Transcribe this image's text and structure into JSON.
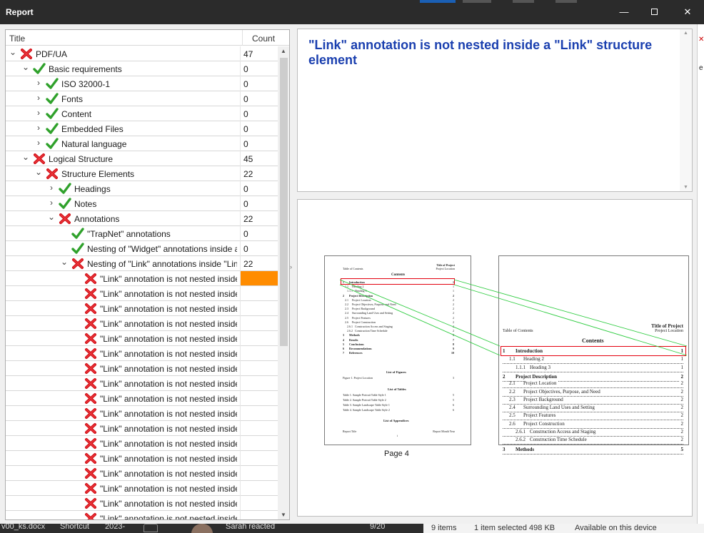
{
  "window": {
    "title": "Report",
    "controls": {
      "minimize": "—",
      "close": "✕"
    }
  },
  "tree": {
    "columns": {
      "title": "Title",
      "count": "Count"
    },
    "rows": [
      {
        "label": "PDF/UA",
        "count": "47",
        "status": "fail",
        "expander": "open",
        "level": 0
      },
      {
        "label": "Basic requirements",
        "count": "0",
        "status": "pass",
        "expander": "open",
        "level": 1
      },
      {
        "label": "ISO 32000-1",
        "count": "0",
        "status": "pass",
        "expander": "closed",
        "level": 2
      },
      {
        "label": "Fonts",
        "count": "0",
        "status": "pass",
        "expander": "closed",
        "level": 2
      },
      {
        "label": "Content",
        "count": "0",
        "status": "pass",
        "expander": "closed",
        "level": 2
      },
      {
        "label": "Embedded Files",
        "count": "0",
        "status": "pass",
        "expander": "closed",
        "level": 2
      },
      {
        "label": "Natural language",
        "count": "0",
        "status": "pass",
        "expander": "closed",
        "level": 2
      },
      {
        "label": "Logical Structure",
        "count": "45",
        "status": "fail",
        "expander": "open",
        "level": 1
      },
      {
        "label": "Structure Elements",
        "count": "22",
        "status": "fail",
        "expander": "open",
        "level": 2
      },
      {
        "label": "Headings",
        "count": "0",
        "status": "pass",
        "expander": "closed",
        "level": 3
      },
      {
        "label": "Notes",
        "count": "0",
        "status": "pass",
        "expander": "closed",
        "level": 3
      },
      {
        "label": "Annotations",
        "count": "22",
        "status": "fail",
        "expander": "open",
        "level": 3
      },
      {
        "label": "\"TrapNet\" annotations",
        "count": "0",
        "status": "pass",
        "expander": "none",
        "level": 4
      },
      {
        "label": "Nesting of \"Widget\" annotations inside a \"...",
        "count": "0",
        "status": "pass",
        "expander": "none",
        "level": 4
      },
      {
        "label": "Nesting of \"Link\" annotations inside \"Link\" ...",
        "count": "22",
        "status": "fail",
        "expander": "open",
        "level": 4
      },
      {
        "label": "\"Link\" annotation is not nested inside ...",
        "count": "",
        "status": "fail",
        "expander": "none",
        "level": 5,
        "selected": true
      },
      {
        "label": "\"Link\" annotation is not nested inside ...",
        "count": "",
        "status": "fail",
        "expander": "none",
        "level": 5
      },
      {
        "label": "\"Link\" annotation is not nested inside ...",
        "count": "",
        "status": "fail",
        "expander": "none",
        "level": 5
      },
      {
        "label": "\"Link\" annotation is not nested inside ...",
        "count": "",
        "status": "fail",
        "expander": "none",
        "level": 5
      },
      {
        "label": "\"Link\" annotation is not nested inside ...",
        "count": "",
        "status": "fail",
        "expander": "none",
        "level": 5
      },
      {
        "label": "\"Link\" annotation is not nested inside ...",
        "count": "",
        "status": "fail",
        "expander": "none",
        "level": 5
      },
      {
        "label": "\"Link\" annotation is not nested inside ...",
        "count": "",
        "status": "fail",
        "expander": "none",
        "level": 5
      },
      {
        "label": "\"Link\" annotation is not nested inside ...",
        "count": "",
        "status": "fail",
        "expander": "none",
        "level": 5
      },
      {
        "label": "\"Link\" annotation is not nested inside ...",
        "count": "",
        "status": "fail",
        "expander": "none",
        "level": 5
      },
      {
        "label": "\"Link\" annotation is not nested inside ...",
        "count": "",
        "status": "fail",
        "expander": "none",
        "level": 5
      },
      {
        "label": "\"Link\" annotation is not nested inside ...",
        "count": "",
        "status": "fail",
        "expander": "none",
        "level": 5
      },
      {
        "label": "\"Link\" annotation is not nested inside ...",
        "count": "",
        "status": "fail",
        "expander": "none",
        "level": 5
      },
      {
        "label": "\"Link\" annotation is not nested inside ...",
        "count": "",
        "status": "fail",
        "expander": "none",
        "level": 5
      },
      {
        "label": "\"Link\" annotation is not nested inside ...",
        "count": "",
        "status": "fail",
        "expander": "none",
        "level": 5
      },
      {
        "label": "\"Link\" annotation is not nested inside ...",
        "count": "",
        "status": "fail",
        "expander": "none",
        "level": 5
      },
      {
        "label": "\"Link\" annotation is not nested inside ...",
        "count": "",
        "status": "fail",
        "expander": "none",
        "level": 5
      },
      {
        "label": "\"Link\" annotation is not nested inside ...",
        "count": "",
        "status": "fail",
        "expander": "none",
        "level": 5
      },
      {
        "label": "\"Link\" annotation is not nested inside ...",
        "count": "",
        "status": "fail",
        "expander": "none",
        "level": 5
      }
    ]
  },
  "description": {
    "title": "\"Link\" annotation is not nested inside a \"Link\" structure element"
  },
  "preview": {
    "page_caption": "Page 4",
    "small_page": {
      "left_header": "Table of Contents",
      "right_header_1": "Title of Project",
      "right_header_2": "Project Location",
      "heading": "Contents",
      "toc": [
        {
          "n": "1",
          "t": "Introduction",
          "p": "1"
        },
        {
          "n": "1.1",
          "t": "Heading 2",
          "p": "1"
        },
        {
          "n": "1.1.1",
          "t": "Heading 3",
          "p": "1"
        },
        {
          "n": "2",
          "t": "Project Description",
          "p": "2"
        },
        {
          "n": "2.1",
          "t": "Project Location",
          "p": "2"
        },
        {
          "n": "2.2",
          "t": "Project Objectives, Purpose, and Need",
          "p": "2"
        },
        {
          "n": "2.3",
          "t": "Project Background",
          "p": "2"
        },
        {
          "n": "2.4",
          "t": "Surrounding Land Uses and Setting",
          "p": "2"
        },
        {
          "n": "2.5",
          "t": "Project Features",
          "p": "2"
        },
        {
          "n": "2.6",
          "t": "Project Construction",
          "p": "2"
        },
        {
          "n": "2.6.1",
          "t": "Construction Access and Staging",
          "p": "2"
        },
        {
          "n": "2.6.2",
          "t": "Construction Time Schedule",
          "p": "2"
        },
        {
          "n": "3",
          "t": "Methods",
          "p": "5"
        },
        {
          "n": "4",
          "t": "Results",
          "p": "7"
        },
        {
          "n": "5",
          "t": "Conclusions",
          "p": "8"
        },
        {
          "n": "6",
          "t": "Recommendations",
          "p": "9"
        },
        {
          "n": "7",
          "t": "References",
          "p": "10"
        }
      ],
      "figures_heading": "List of Figures",
      "figures": [
        {
          "t": "Figure 1. Project Location",
          "p": "3"
        }
      ],
      "tables_heading": "List of Tables",
      "tables": [
        {
          "t": "Table 1. Sample Portrait Table Style 1",
          "p": "5"
        },
        {
          "t": "Table 2. Sample Portrait Table Style 2",
          "p": "5"
        },
        {
          "t": "Table 3. Sample Landscape Table Style 1",
          "p": "6"
        },
        {
          "t": "Table 4. Sample Landscape Table Style 2",
          "p": "6"
        }
      ],
      "appendices_heading": "List of Appendices",
      "footer_left": "Report Title",
      "footer_center": "i",
      "footer_right": "Report Month Year"
    },
    "zoom_page": {
      "right_header_1": "Title of Project",
      "left_header": "Table of Contents",
      "right_header_2": "Project Location",
      "heading": "Contents",
      "toc": [
        {
          "n": "1",
          "t": "Introduction",
          "p": "1",
          "bold": true,
          "indent": 0
        },
        {
          "n": "1.1",
          "t": "Heading 2",
          "p": "1",
          "bold": false,
          "indent": 1
        },
        {
          "n": "1.1.1",
          "t": "Heading 3",
          "p": "1",
          "bold": false,
          "indent": 2
        },
        {
          "n": "2",
          "t": "Project Description",
          "p": "2",
          "bold": true,
          "indent": 0
        },
        {
          "n": "2.1",
          "t": "Project Location",
          "p": "2",
          "bold": false,
          "indent": 1
        },
        {
          "n": "2.2",
          "t": "Project Objectives, Purpose, and Need",
          "p": "2",
          "bold": false,
          "indent": 1
        },
        {
          "n": "2.3",
          "t": "Project Background",
          "p": "2",
          "bold": false,
          "indent": 1
        },
        {
          "n": "2.4",
          "t": "Surrounding Land Uses and Setting",
          "p": "2",
          "bold": false,
          "indent": 1
        },
        {
          "n": "2.5",
          "t": "Project Features",
          "p": "2",
          "bold": false,
          "indent": 1
        },
        {
          "n": "2.6",
          "t": "Project Construction",
          "p": "2",
          "bold": false,
          "indent": 1
        },
        {
          "n": "2.6.1",
          "t": "Construction Access and Staging",
          "p": "2",
          "bold": false,
          "indent": 2
        },
        {
          "n": "2.6.2",
          "t": "Construction Time Schedule",
          "p": "2",
          "bold": false,
          "indent": 2
        },
        {
          "n": "3",
          "t": "Methods",
          "p": "5",
          "bold": true,
          "indent": 0
        }
      ]
    }
  },
  "taskbar": {
    "file": "v00_ks.docx",
    "type": "Shortcut",
    "date": "2023-",
    "notification": "Sarah reacted",
    "counter": "9/20",
    "items": "9 items",
    "selected": "1 item selected  498 KB",
    "availability": "Available on this device"
  },
  "colors": {
    "fail": "#d4121a",
    "pass": "#2fa12b",
    "selection": "#ff8c00",
    "heading_blue": "#1a3faf",
    "link_highlight": "#e3000f",
    "connector": "#2ecc40"
  }
}
